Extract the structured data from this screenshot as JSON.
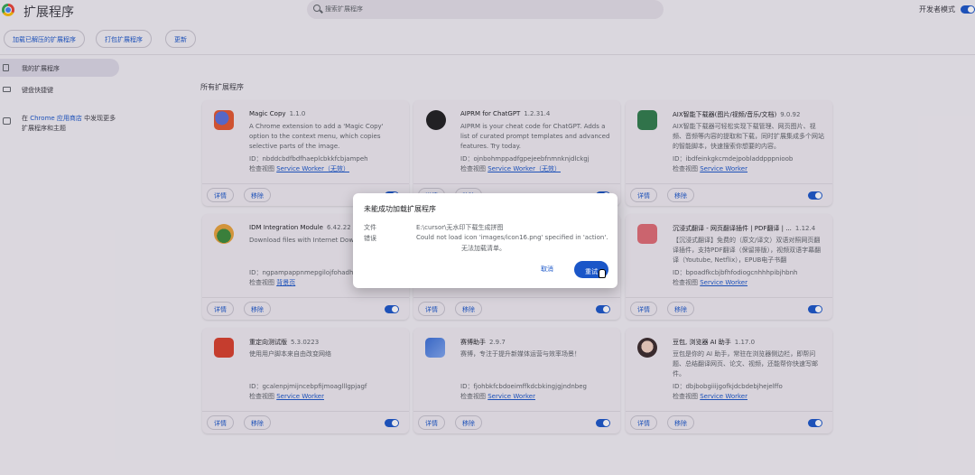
{
  "header": {
    "title": "扩展程序",
    "search_placeholder": "搜索扩展程序",
    "dev_mode_label": "开发者模式"
  },
  "toolbar": {
    "load_unpacked": "加载已解压的扩展程序",
    "pack": "打包扩展程序",
    "update": "更新"
  },
  "sidebar": {
    "my_extensions": "我的扩展程序",
    "shortcuts": "键盘快捷键",
    "note_prefix": "在 ",
    "note_link": "Chrome 应用商店",
    "note_suffix": " 中发现更多扩展程序和主题"
  },
  "section_title": "所有扩展程序",
  "card_buttons": {
    "details": "详情",
    "remove": "移除"
  },
  "inspect_label": "检查视图",
  "cards": [
    {
      "name": "Magic Copy",
      "version": "1.1.0",
      "desc": "A Chrome extension to add a 'Magic Copy' option to the context menu, which copies selective parts of the image.",
      "id": "ID：nbddcbdfbdfhaeplcbkkfcbjampeh",
      "inspect": "Service Worker（无效）"
    },
    {
      "name": "AIPRM for ChatGPT",
      "version": "1.2.31.4",
      "desc": "AIPRM is your cheat code for ChatGPT. Adds a list of curated prompt templates and advanced features. Try today.",
      "id": "ID：ojnbohmppadfgpejeebfnmnknjdlckgj",
      "inspect": "Service Worker（无效）"
    },
    {
      "name": "AIX智能下载器(图片/视频/音乐/文档)",
      "version": "9.0.92",
      "desc": "AIX智能下载器可轻松实现下载管理、网页图片、视频、音频等内容的提取和下载，同时扩展集成多个网站的智能脚本，快速搜索你想要的内容。",
      "id": "ID：ibdfeinkgkcmdejpobladdpppnioob",
      "inspect": "Service Worker"
    },
    {
      "name": "IDM Integration Module",
      "version": "6.42.22",
      "desc": "Download files with Internet Download Manager",
      "id": "ID：ngpampappnmepgilojfohadhhmbhlaek",
      "inspect": "背景页"
    },
    {
      "name": "沉浸式翻译 - 网页翻译插件 | PDF翻译 | ...",
      "version": "1.12.4",
      "desc": "【沉浸式翻译】免费的（原文/译文）双语对照网页翻译插件，支持PDF翻译（保留排版），视频双语字幕翻译（Youtube, Netflix），EPUB电子书翻",
      "id": "ID：bpoadfkcbjbfhfodiogcnhhhpibjhbnh",
      "inspect": "Service Worker"
    },
    {
      "name": "重定向测试版",
      "version": "5.3.0223",
      "desc": "使用用户脚本来自由改变网络",
      "id": "ID：gcalenpjmijncebpfijmoaglllgpjagf",
      "inspect": "Service Worker"
    },
    {
      "name": "赛博助手",
      "version": "2.9.7",
      "desc": "赛博，专注于提升新媒体运营与效率场景！",
      "id": "ID：fjohbkfcbdoeimffkdcbkingjgjndnbeg",
      "inspect": "Service Worker"
    },
    {
      "name": "豆包, 浏览器 AI 助手",
      "version": "1.17.0",
      "desc": "豆包是你的 AI 助手，常驻在浏览器侧边栏，即帮问题、总结翻译网页、论文、视频，还能帮你快速写邮件。",
      "id": "ID：dbjbobgiiijgofkjdcbdebjhejelffo",
      "inspect": "Service Worker"
    }
  ],
  "dialog": {
    "title": "未能成功加载扩展程序",
    "file_label": "文件",
    "file_value": "E:\\cursor\\无水印下载生成拼图",
    "error_label": "错误",
    "error_line1": "Could not load icon 'images/icon16.png' specified in 'action'.",
    "error_line2": "无法加载清单。",
    "cancel": "取消",
    "retry": "重试"
  },
  "colors": {
    "accent": "#1a56c8",
    "background": "#f1eef3"
  }
}
